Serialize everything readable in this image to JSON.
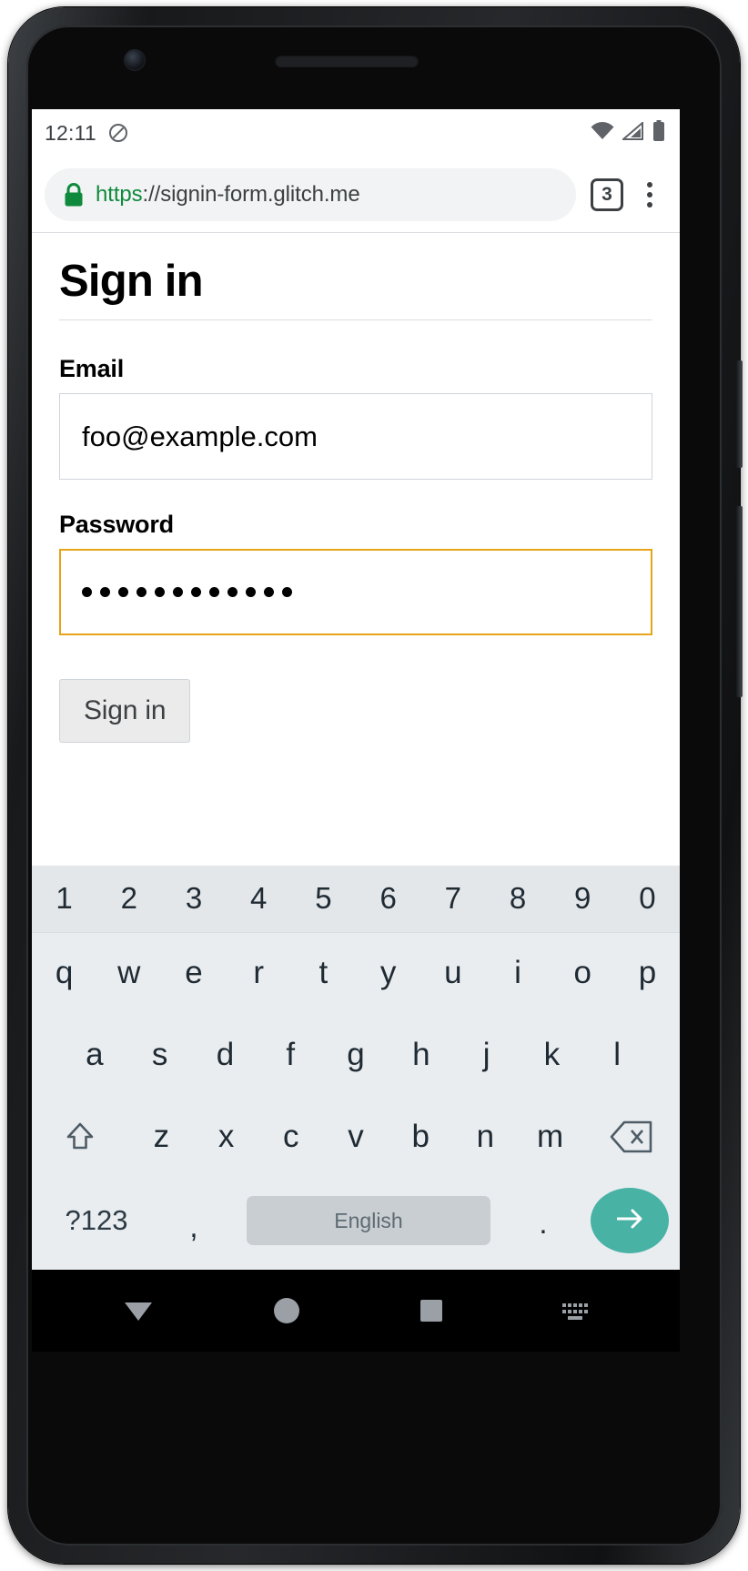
{
  "status_bar": {
    "clock": "12:11",
    "icons": [
      "dnd-icon",
      "wifi-icon",
      "signal-icon",
      "battery-icon"
    ]
  },
  "browser": {
    "url_scheme": "https",
    "url_separator": "://",
    "url_host": "signin-form.glitch.me",
    "lock_icon": "lock-icon",
    "tab_count": "3",
    "menu_icon": "overflow-menu-icon"
  },
  "page": {
    "title": "Sign in",
    "email": {
      "label": "Email",
      "value": "foo@example.com"
    },
    "password": {
      "label": "Password",
      "masked_value": "••••••••••••",
      "dot_count": 12,
      "focused": true,
      "focus_color": "#e8a317"
    },
    "submit_label": "Sign in"
  },
  "keyboard": {
    "number_row": [
      "1",
      "2",
      "3",
      "4",
      "5",
      "6",
      "7",
      "8",
      "9",
      "0"
    ],
    "row_top": [
      "q",
      "w",
      "e",
      "r",
      "t",
      "y",
      "u",
      "i",
      "o",
      "p"
    ],
    "row_home": [
      "a",
      "s",
      "d",
      "f",
      "g",
      "h",
      "j",
      "k",
      "l"
    ],
    "row_bottom": [
      "z",
      "x",
      "c",
      "v",
      "b",
      "n",
      "m"
    ],
    "shift_icon": "shift-icon",
    "backspace_icon": "backspace-icon",
    "symbols_label": "?123",
    "comma_label": ",",
    "space_label": "English",
    "period_label": ".",
    "enter_icon": "arrow-right-icon",
    "enter_color": "#48b2a5"
  },
  "nav_bar": {
    "back_icon": "back-triangle-icon",
    "home_icon": "home-circle-icon",
    "recents_icon": "recents-square-icon",
    "keyboard_icon": "keyboard-icon"
  }
}
